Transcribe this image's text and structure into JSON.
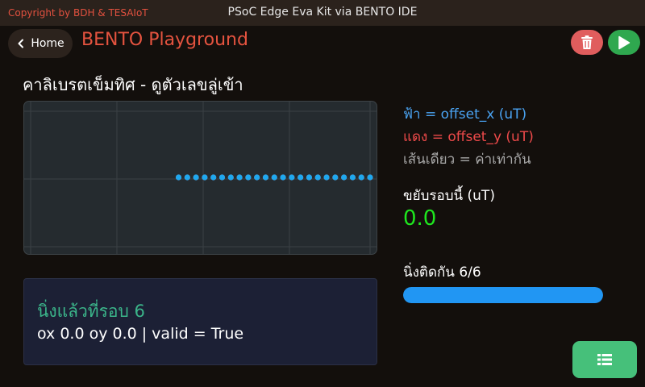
{
  "topbar": {
    "copyright": "Copyright by BDH & TESAIoT",
    "title": "PSoC Edge Eva Kit via BENTO IDE"
  },
  "header": {
    "home_label": "Home",
    "title": "BENTO Playground",
    "delete_icon": "trash-icon",
    "run_icon": "play-icon"
  },
  "main": {
    "heading": "คาลิเบรตเข็มทิศ - ดูตัวเลขลู่เข้า"
  },
  "legend": {
    "x_label": "ฟ้า = offset_x (uT)",
    "y_label": "แดง = offset_y (uT)",
    "eq_label": "เส้นเดียว = ค่าเท่ากัน"
  },
  "stats": {
    "delta_label": "ขยับรอบนี้ (uT)",
    "delta_value": "0.0",
    "still_label": "นิ่งติดกัน 6/6",
    "still_progress": 1.0
  },
  "status": {
    "title": "นิ่งแล้วที่รอบ 6",
    "detail": "ox 0.0 oy 0.0 | valid = True"
  },
  "footer": {
    "list_icon": "list-icon"
  },
  "colors": {
    "accent": "#e4533f",
    "offset_x": "#1ea8ef",
    "offset_y": "#ee4a4a",
    "success": "#1ee61e",
    "progress": "#2196f3"
  },
  "chart_data": {
    "type": "line",
    "x_points": 40,
    "first_visible_point": 17,
    "series": [
      {
        "name": "offset_x",
        "value": 0.0,
        "color": "#1ea8ef"
      },
      {
        "name": "offset_y",
        "value": 0.0,
        "color": "#ee4a4a"
      }
    ],
    "grid": true
  }
}
